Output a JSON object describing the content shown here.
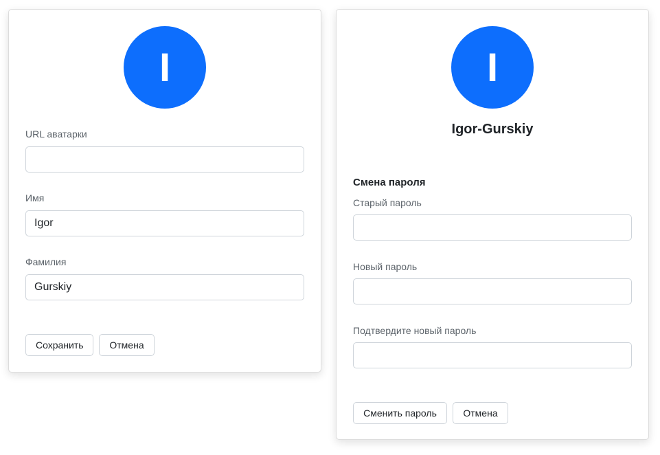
{
  "profile_form": {
    "avatar_initial": "I",
    "avatar_url_label": "URL аватарки",
    "avatar_url_value": "",
    "first_name_label": "Имя",
    "first_name_value": "Igor",
    "last_name_label": "Фамилия",
    "last_name_value": "Gurskiy",
    "save_label": "Сохранить",
    "cancel_label": "Отмена"
  },
  "password_form": {
    "avatar_initial": "I",
    "username": "Igor-Gurskiy",
    "section_title": "Смена пароля",
    "old_password_label": "Старый пароль",
    "old_password_value": "",
    "new_password_label": "Новый пароль",
    "new_password_value": "",
    "confirm_password_label": "Подтвердите новый пароль",
    "confirm_password_value": "",
    "change_label": "Сменить пароль",
    "cancel_label": "Отмена"
  },
  "colors": {
    "avatar_bg": "#0d6efd",
    "avatar_text": "#ffffff",
    "border": "#ced4da"
  }
}
